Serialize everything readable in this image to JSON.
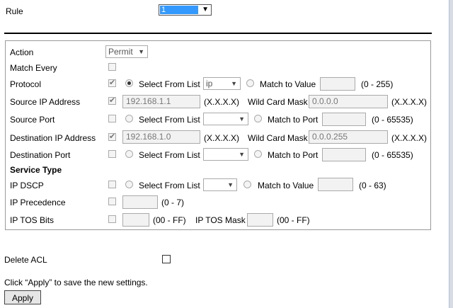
{
  "rule": {
    "label": "Rule",
    "selected": "1"
  },
  "form": {
    "action": {
      "label": "Action",
      "value": "Permit"
    },
    "match_every": {
      "label": "Match Every",
      "checked": false
    },
    "protocol": {
      "label": "Protocol",
      "checked": true,
      "select_from_list_label": "Select From List",
      "list_value": "ip",
      "match_to_value_label": "Match to Value",
      "value": "",
      "range": "(0 - 255)"
    },
    "source_ip": {
      "label": "Source IP Address",
      "checked": true,
      "value": "192.168.1.1",
      "format": "(X.X.X.X)",
      "wildcard_label": "Wild Card Mask",
      "wildcard_value": "0.0.0.0",
      "wildcard_format": "(X.X.X.X)"
    },
    "source_port": {
      "label": "Source Port",
      "checked": false,
      "select_from_list_label": "Select From List",
      "list_value": "",
      "match_to_port_label": "Match to Port",
      "value": "",
      "range": "(0 - 65535)"
    },
    "destination_ip": {
      "label": "Destination IP Address",
      "checked": true,
      "value": "192.168.1.0",
      "format": "(X.X.X.X)",
      "wildcard_label": "Wild Card Mask",
      "wildcard_value": "0.0.0.255",
      "wildcard_format": "(X.X.X.X)"
    },
    "destination_port": {
      "label": "Destination Port",
      "checked": false,
      "select_from_list_label": "Select From List",
      "list_value": "",
      "match_to_port_label": "Match to Port",
      "value": "",
      "range": "(0 - 65535)"
    },
    "service_type": {
      "heading": "Service Type"
    },
    "ip_dscp": {
      "label": "IP DSCP",
      "checked": false,
      "select_from_list_label": "Select From List",
      "list_value": "",
      "match_to_value_label": "Match to Value",
      "value": "",
      "range": "(0 - 63)"
    },
    "ip_precedence": {
      "label": "IP Precedence",
      "checked": false,
      "value": "",
      "range": "(0 - 7)"
    },
    "ip_tos": {
      "label": "IP TOS Bits",
      "checked": false,
      "value": "",
      "range": "(00 - FF)",
      "mask_label": "IP TOS Mask",
      "mask_value": "",
      "mask_range": "(00 - FF)"
    }
  },
  "delete_acl": {
    "label": "Delete ACL",
    "checked": false
  },
  "footer": {
    "hint": "Click “Apply” to save the new settings.",
    "apply_label": "Apply"
  }
}
